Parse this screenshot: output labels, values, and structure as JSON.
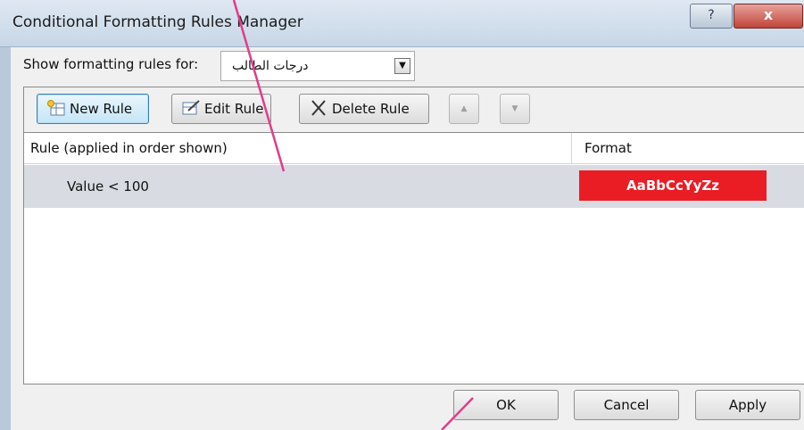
{
  "dialog": {
    "title": "Conditional Formatting Rules Manager",
    "help_label": "?",
    "close_label": "x"
  },
  "show_for": {
    "label": "Show formatting rules for:",
    "selected_value": "درجات الطالب"
  },
  "toolbar": {
    "new_rule": "New Rule",
    "edit_rule": "Edit Rule",
    "delete_rule": "Delete Rule",
    "move_up": "▲",
    "move_down": "▼"
  },
  "rules_list": {
    "columns": [
      "Rule (applied in order shown)",
      "Format"
    ],
    "rows": [
      {
        "rule": "Value < 100",
        "format_preview": "AaBbCcYyZz",
        "format_color": "#ea1c24"
      }
    ]
  },
  "footer": {
    "ok": "OK",
    "cancel": "Cancel",
    "apply": "Apply"
  },
  "colors": {
    "accent_annotation": "#e23c8c",
    "title_bar": "#c7d6e6",
    "selected_row": "#d8dce2"
  }
}
